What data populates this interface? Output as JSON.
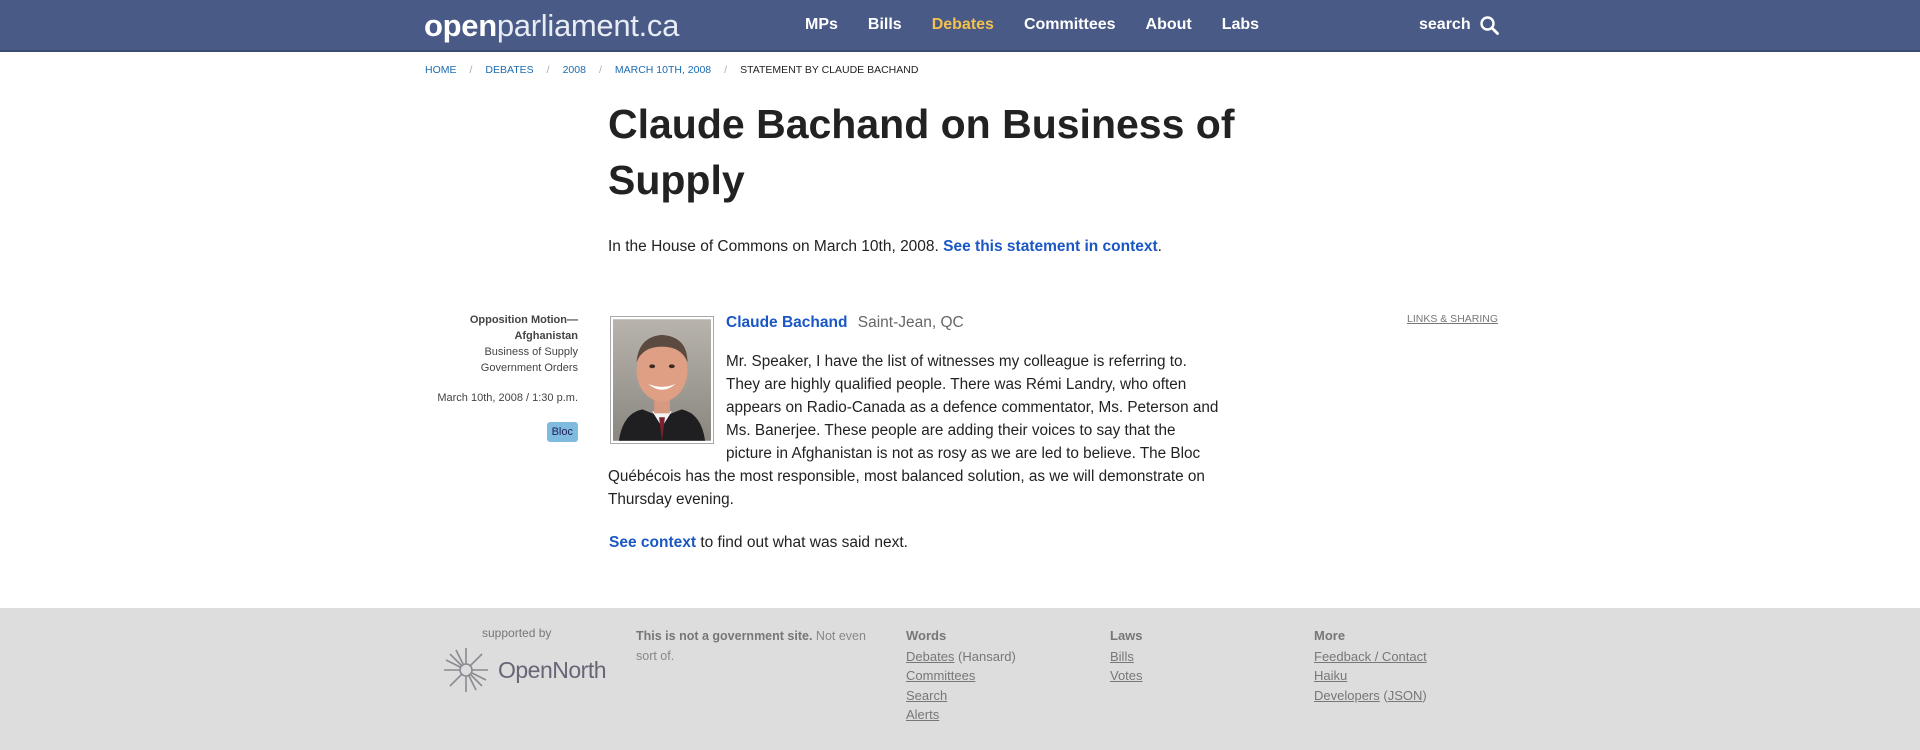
{
  "header": {
    "logo_bold": "open",
    "logo_light": "parliament.ca",
    "nav": [
      "MPs",
      "Bills",
      "Debates",
      "Committees",
      "About",
      "Labs"
    ],
    "active_nav": "Debates",
    "search_label": "search"
  },
  "breadcrumb": [
    "HOME",
    "DEBATES",
    "2008",
    "MARCH 10TH, 2008",
    "STATEMENT BY CLAUDE BACHAND"
  ],
  "page": {
    "title": "Claude Bachand on Business of Supply",
    "intro_text": "In the House of Commons on March 10th, 2008.",
    "intro_link": "See this statement in context",
    "intro_end": "."
  },
  "meta": {
    "topic": "Opposition Motion—Afghanistan",
    "section": "Business of Supply",
    "category": "Government Orders",
    "time": "March 10th, 2008 / 1:30 p.m.",
    "party": "Bloc",
    "party_color": "#7fbadf"
  },
  "statement": {
    "speaker": "Claude Bachand",
    "riding": "Saint-Jean, QC",
    "text": "Mr. Speaker, I have the list of witnesses my colleague is referring to. They are highly qualified people. There was Rémi Landry, who often appears on Radio-Canada as a defence commentator, Ms. Peterson and Ms. Banerjee. These people are adding their voices to say that the picture in Afghanistan is not as rosy as we are led to believe. The Bloc Québécois has the most responsible, most balanced solution, as we will demonstrate on Thursday evening.",
    "next_link": "See context",
    "next_text": " to find out what was said next.",
    "share_label": "LINKS & SHARING"
  },
  "footer": {
    "supported_by": "supported by",
    "sponsor": "OpenNorth",
    "disclaimer_bold": "This is not a government site.",
    "disclaimer_rest": " Not even sort of.",
    "words_heading": "Words",
    "words": {
      "debates": "Debates",
      "hansard": " (Hansard)",
      "committees": "Committees",
      "search": "Search",
      "alerts": "Alerts"
    },
    "laws_heading": "Laws",
    "laws": {
      "bills": "Bills",
      "votes": "Votes"
    },
    "more_heading": "More",
    "more": {
      "feedback": "Feedback / Contact",
      "haiku": "Haiku",
      "developers": "Developers",
      "json": "JSON"
    }
  }
}
